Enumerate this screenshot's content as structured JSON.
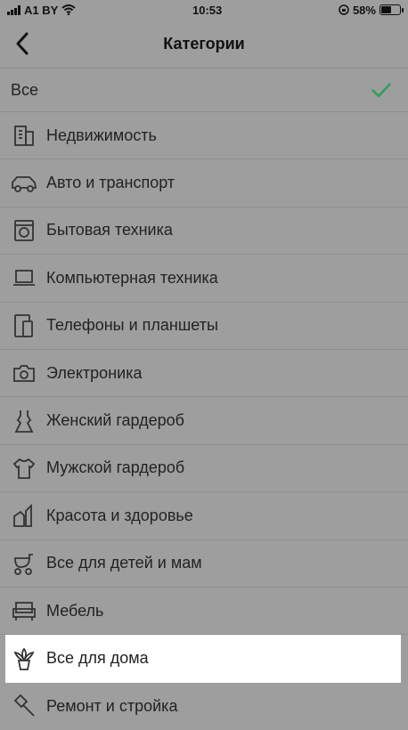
{
  "status": {
    "carrier": "A1 BY",
    "time": "10:53",
    "battery": "58%",
    "battery_level": 0.58
  },
  "nav": {
    "title": "Категории"
  },
  "accent_color": "#2e9e5b",
  "list": {
    "all_label": "Все",
    "items": [
      {
        "label": "Недвижимость",
        "icon": "building-icon"
      },
      {
        "label": "Авто и транспорт",
        "icon": "car-icon"
      },
      {
        "label": "Бытовая техника",
        "icon": "washing-machine-icon"
      },
      {
        "label": "Компьютерная техника",
        "icon": "laptop-icon"
      },
      {
        "label": "Телефоны и планшеты",
        "icon": "phone-tablet-icon"
      },
      {
        "label": "Электроника",
        "icon": "camera-icon"
      },
      {
        "label": "Женский гардероб",
        "icon": "dress-icon"
      },
      {
        "label": "Мужской гардероб",
        "icon": "tshirt-icon"
      },
      {
        "label": "Красота и здоровье",
        "icon": "cosmetics-icon"
      },
      {
        "label": "Все для детей и мам",
        "icon": "stroller-icon"
      },
      {
        "label": "Мебель",
        "icon": "armchair-icon"
      },
      {
        "label": "Все для дома",
        "icon": "plant-icon"
      },
      {
        "label": "Ремонт и стройка",
        "icon": "hammer-icon"
      }
    ]
  }
}
